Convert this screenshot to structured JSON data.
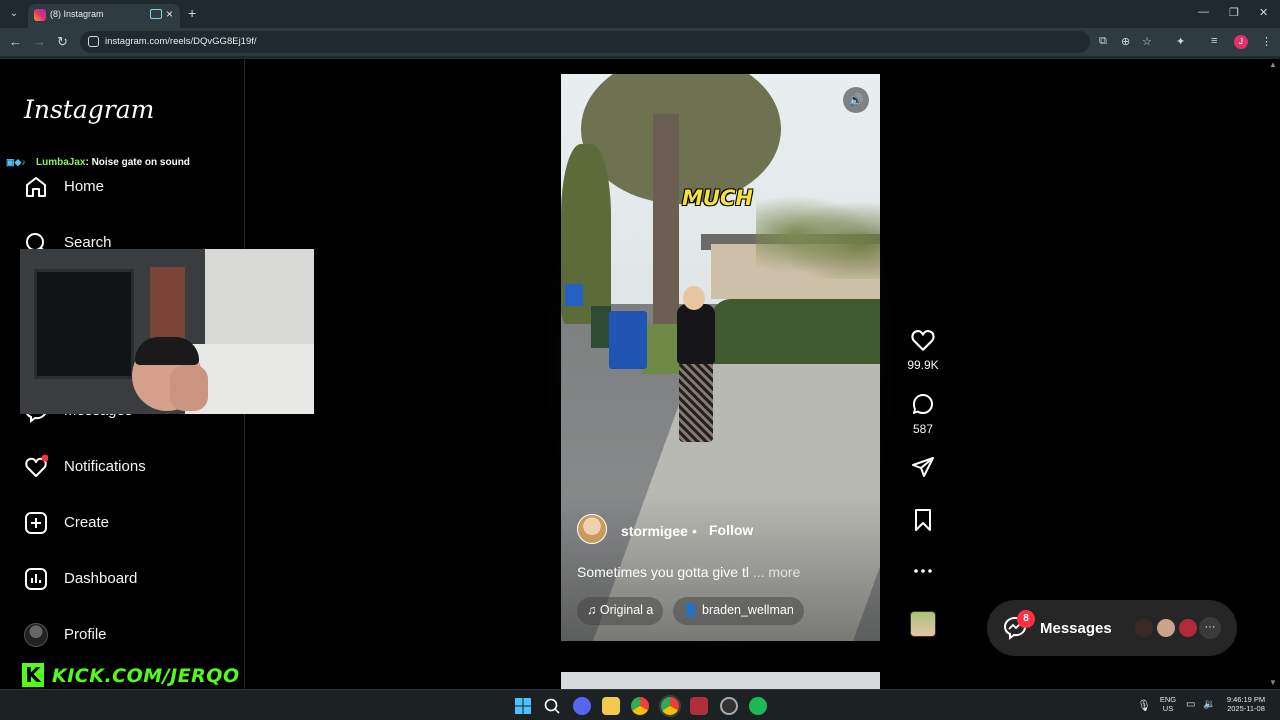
{
  "browser": {
    "tab_title": "(8) Instagram",
    "url": "instagram.com/reels/DQvGG8Ej19f/"
  },
  "instagram": {
    "logo": "Instagram",
    "nav": [
      {
        "label": "Home"
      },
      {
        "label": "Search"
      },
      {
        "label": "Messages"
      },
      {
        "label": "Notifications"
      },
      {
        "label": "Create"
      },
      {
        "label": "Dashboard"
      },
      {
        "label": "Profile"
      }
    ]
  },
  "stream_overlay": {
    "chat_user": "LumbaJax",
    "chat_message": ": Noise gate on sound",
    "kick_url": "KICK.COM/JERQO"
  },
  "reel": {
    "overlay_text": "MUCH",
    "author": "stormigee",
    "separator": "•",
    "follow_label": "Follow",
    "caption": "Sometimes you gotta give tl",
    "caption_more": "... more",
    "audio_label": "Original a",
    "tagged_user": "braden_wellman",
    "likes": "99.9K",
    "comments": "587"
  },
  "messages_widget": {
    "label": "Messages",
    "badge": "8",
    "more": "···"
  },
  "taskbar": {
    "lang_top": "ENG",
    "lang_bottom": "US",
    "time": "9:46:19 PM",
    "date": "2025-11-08"
  },
  "colors": {
    "kick_green": "#53fc18",
    "notification_red": "#ff3040",
    "overlay_yellow": "#f5e23a"
  }
}
